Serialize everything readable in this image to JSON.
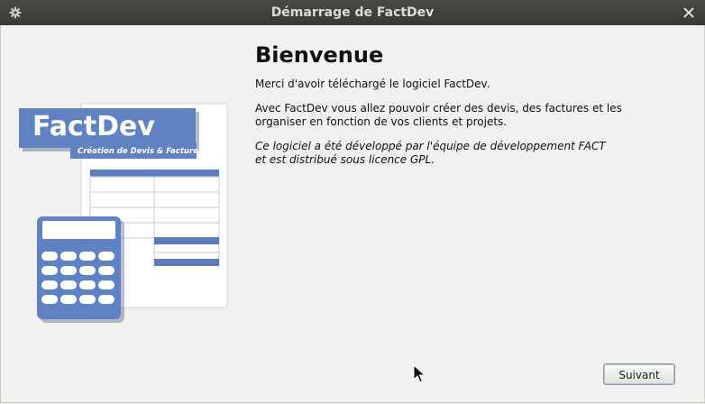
{
  "window": {
    "title": "Démarrage de FactDev"
  },
  "logo": {
    "name": "FactDev",
    "tagline": "Création de Devis & Facture"
  },
  "content": {
    "heading": "Bienvenue",
    "thanks": "Merci d'avoir téléchargé le logiciel FactDev.",
    "description_line1": "Avec FactDev vous allez pouvoir créer des devis, des factures et les",
    "description_line2": "organiser en fonction de vos clients et projets.",
    "license_line1": "Ce logiciel a été développé par l'équipe de développement FACT",
    "license_line2": "et est distribué sous licence GPL."
  },
  "buttons": {
    "next_label": "Suivant"
  },
  "icons": {
    "menu": "gear-icon",
    "close": "close-icon",
    "cursor": "mouse-pointer-icon"
  },
  "colors": {
    "titlebar": "#3c3b37",
    "window_bg": "#f2f1f0",
    "brand_blue": "#5b7cbc"
  }
}
